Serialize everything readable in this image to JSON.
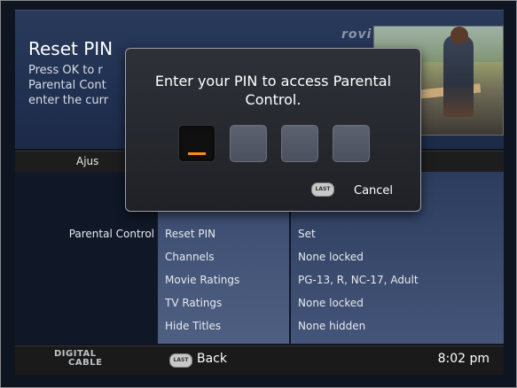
{
  "info": {
    "title": "Reset PIN",
    "description": "Press OK to r\nParental Cont\nenter the curr",
    "provider_logo": "rovi"
  },
  "columns": {
    "left_header": "Ajus"
  },
  "menu": {
    "category": "Parental Control",
    "items": [
      {
        "label": "Reset PIN",
        "value": "Set"
      },
      {
        "label": "Channels",
        "value": "None locked"
      },
      {
        "label": "Movie Ratings",
        "value": "PG-13, R, NC-17, Adult"
      },
      {
        "label": "TV Ratings",
        "value": "None locked"
      },
      {
        "label": "Hide Titles",
        "value": "None hidden"
      }
    ]
  },
  "dialog": {
    "message": "Enter your PIN to access Parental Control.",
    "last_button": "LAST",
    "cancel_label": "Cancel"
  },
  "footer": {
    "brand_line1": "DIGITAL",
    "brand_line2": "CABLE",
    "last_button": "LAST",
    "back_label": "Back",
    "time": "8:02 pm"
  },
  "colors": {
    "accent": "#ff8c1a",
    "panel": "#213152"
  }
}
